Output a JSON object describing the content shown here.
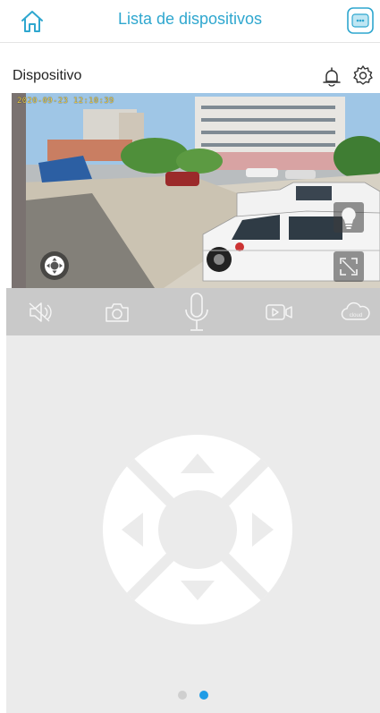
{
  "header": {
    "title": "Lista de dispositivos",
    "home_icon": "home-icon",
    "camera_icon": "camera-device-icon",
    "accent_color": "#2fa7cf"
  },
  "device": {
    "label": "Dispositivo",
    "bell_icon": "bell-icon",
    "gear_icon": "gear-icon"
  },
  "video": {
    "timestamp": "2020-09-23 12:10:39",
    "ptz_icon": "ptz-joystick-icon",
    "light_icon": "lightbulb-icon",
    "fullscreen_icon": "fullscreen-icon"
  },
  "toolbar": {
    "items": [
      {
        "name": "mute",
        "icon": "speaker-muted-icon"
      },
      {
        "name": "snapshot",
        "icon": "camera-icon"
      },
      {
        "name": "talk",
        "icon": "microphone-icon"
      },
      {
        "name": "record",
        "icon": "video-record-icon"
      },
      {
        "name": "cloud",
        "icon": "cloud-icon",
        "label": "cloud"
      }
    ]
  },
  "pager": {
    "pages": 2,
    "active": 2,
    "active_color": "#1f9ce6"
  }
}
